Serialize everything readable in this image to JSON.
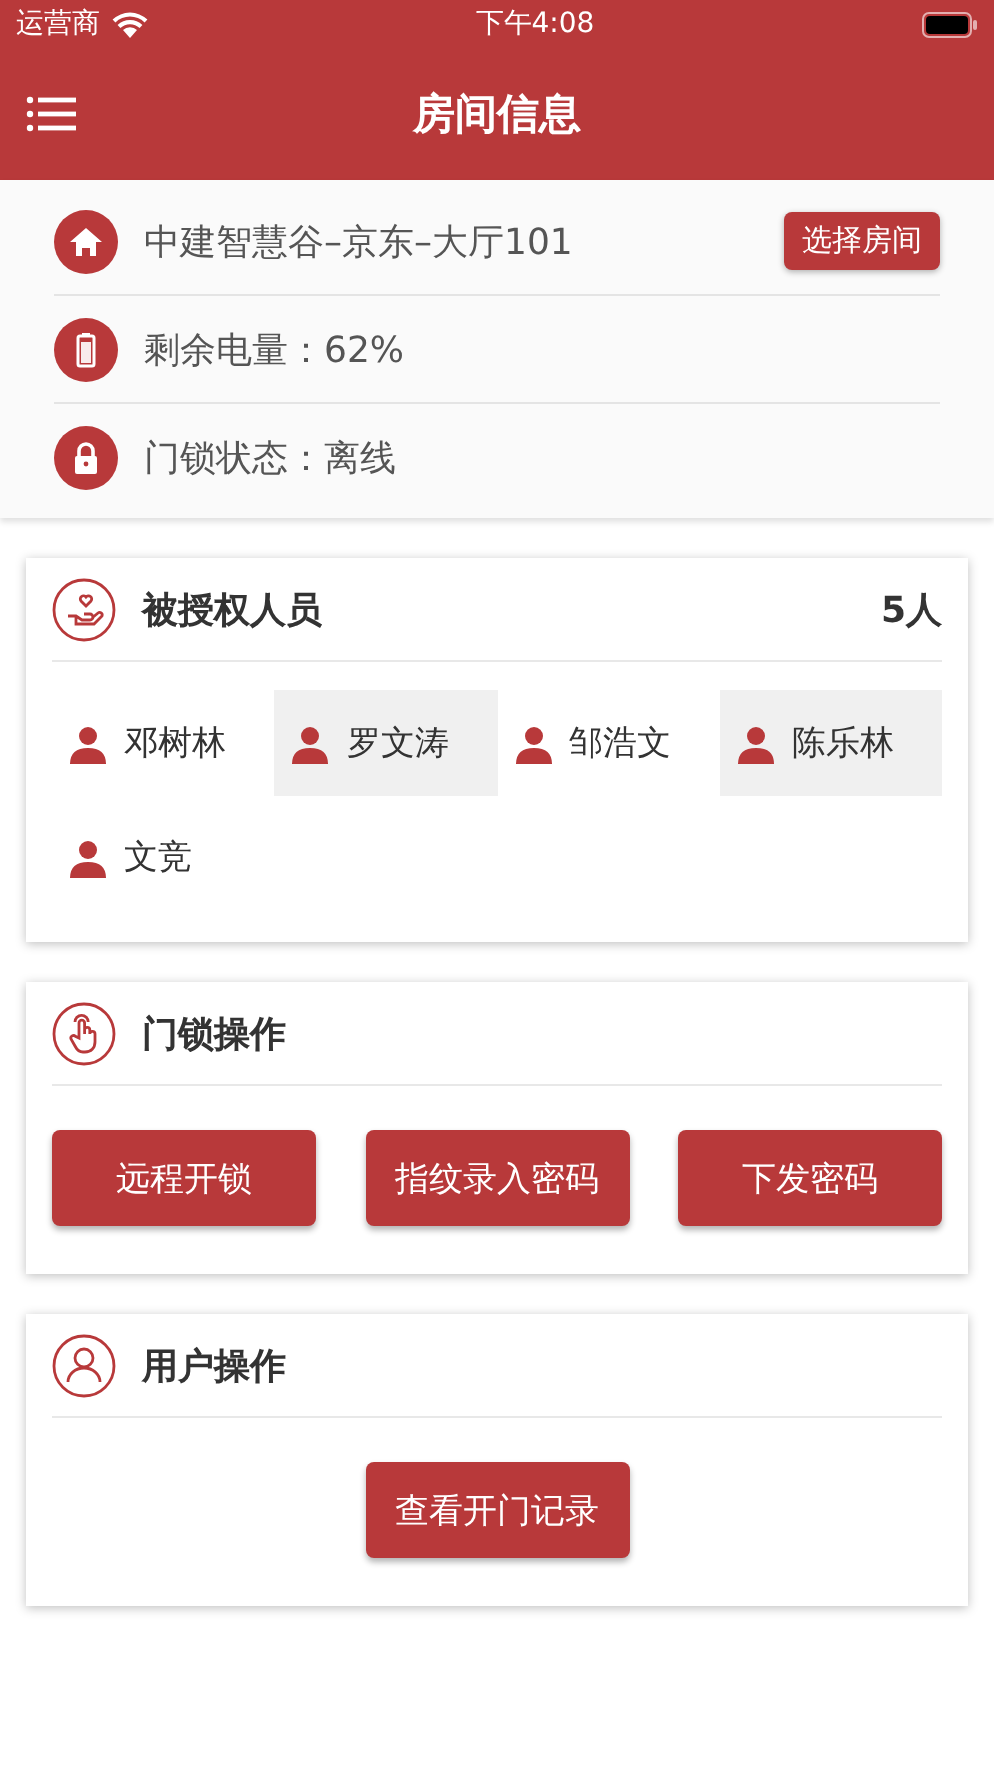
{
  "status_bar": {
    "carrier": "运营商",
    "time": "下午4:08"
  },
  "header": {
    "title": "房间信息"
  },
  "room_info": {
    "rows": [
      {
        "kind": "home",
        "text": "中建智慧谷–京东–大厅101",
        "button": "选择房间"
      },
      {
        "kind": "battery",
        "text": "剩余电量：62%"
      },
      {
        "kind": "lock",
        "text": "门锁状态：离线"
      }
    ]
  },
  "authorized": {
    "title": "被授权人员",
    "count": "5人",
    "people": [
      {
        "name": "邓树林",
        "selected": false
      },
      {
        "name": "罗文涛",
        "selected": true
      },
      {
        "name": "邹浩文",
        "selected": false
      },
      {
        "name": "陈乐林",
        "selected": true
      },
      {
        "name": "文竞",
        "selected": false
      }
    ]
  },
  "lock_ops": {
    "title": "门锁操作",
    "buttons": [
      "远程开锁",
      "指纹录入密码",
      "下发密码"
    ]
  },
  "user_ops": {
    "title": "用户操作",
    "buttons": [
      "查看开门记录"
    ]
  }
}
